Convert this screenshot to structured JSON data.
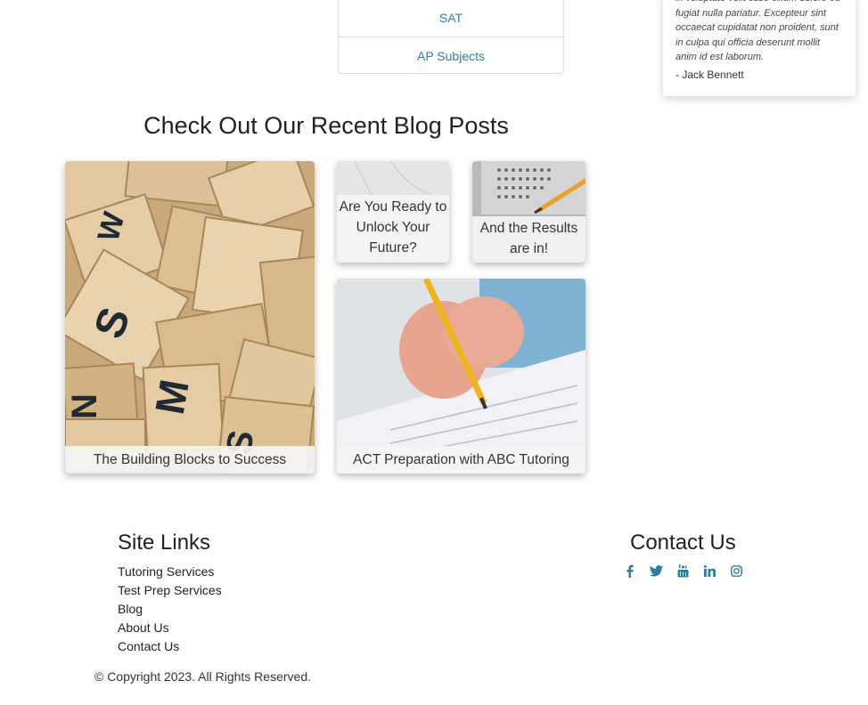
{
  "subjects": {
    "items": [
      "SAT",
      "AP Subjects"
    ]
  },
  "testimonial": {
    "text": "in voluptate velit esse cillum dolore eu fugiat nulla pariatur. Excepteur sint occaecat cupidatat non proident, sunt in culpa qui officia deserunt mollit anim id est laborum.",
    "author": "- Jack Bennett"
  },
  "blog": {
    "heading": "Check Out Our Recent Blog Posts",
    "posts": [
      "The Building Blocks to Success",
      "Are You Ready to Unlock Your Future?",
      "And the Results are in!",
      "ACT Preparation with ABC Tutoring"
    ]
  },
  "footer": {
    "site_links_heading": "Site Links",
    "links": [
      "Tutoring Services",
      "Test Prep Services",
      "Blog",
      "About Us",
      "Contact Us"
    ],
    "contact_heading": "Contact Us",
    "social_icons": [
      "facebook-icon",
      "twitter-icon",
      "youtube-icon",
      "linkedin-icon",
      "instagram-icon"
    ],
    "copyright": "© Copyright 2023. All Rights Reserved."
  },
  "colors": {
    "accent": "#2f7f9a"
  }
}
